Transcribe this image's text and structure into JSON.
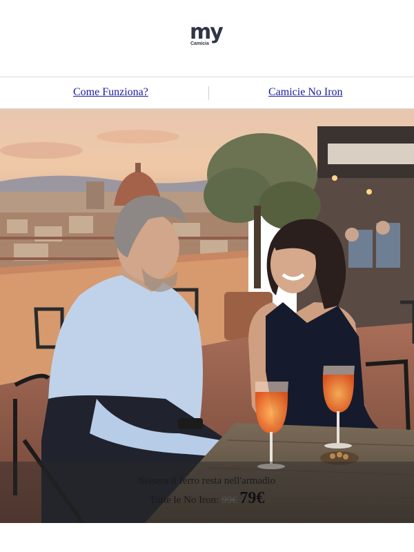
{
  "logo": {
    "main": "my",
    "sub": "Camicia"
  },
  "nav": {
    "link1": "Come Funziona?",
    "link2": "Camicie No Iron"
  },
  "hero": {
    "caption": "Stasera il ferro resta nell'armadio",
    "price_prefix": "Tutte le No Iron:",
    "old_price": "99€",
    "new_price": "79€"
  },
  "colors": {
    "link": "#1a1aa6",
    "logo": "#2f3447"
  }
}
